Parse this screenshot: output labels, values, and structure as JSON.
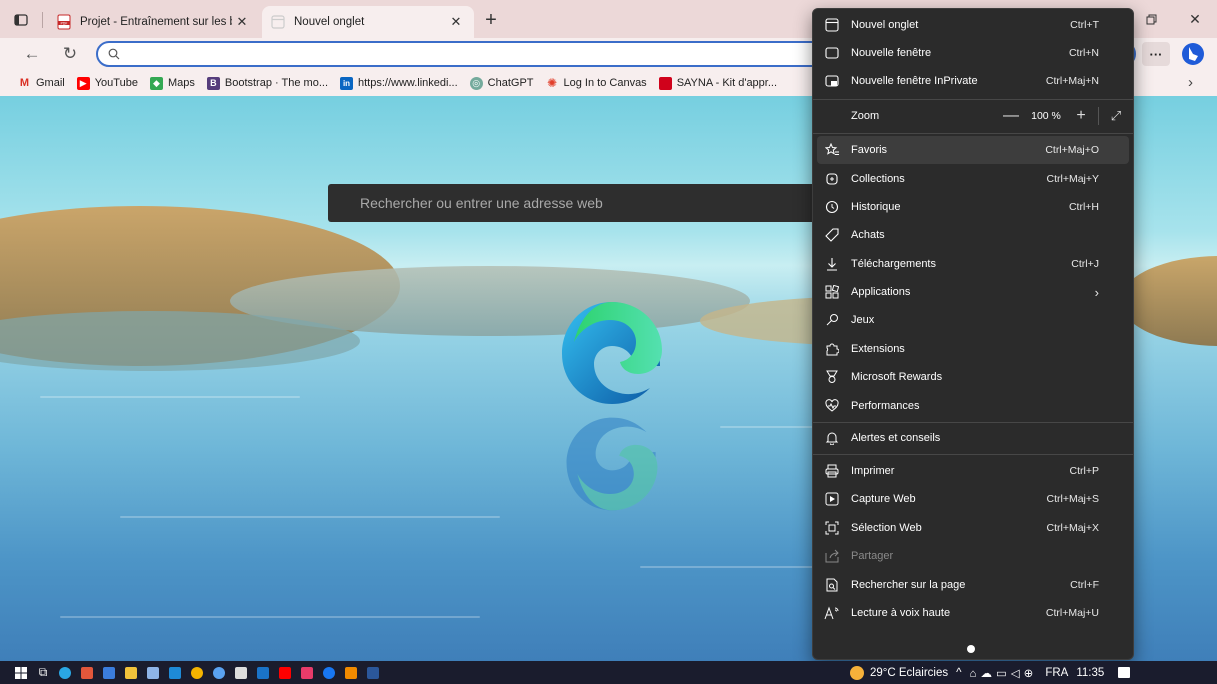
{
  "tabs": [
    {
      "title": "Projet - Entraînement sur les bas",
      "icon": "pdf-icon",
      "active": false
    },
    {
      "title": "Nouvel onglet",
      "icon": "new-tab-page-icon",
      "active": true
    }
  ],
  "address_bar": {
    "value": "",
    "placeholder": ""
  },
  "favorites": [
    {
      "label": "Gmail",
      "icon": "gmail-icon",
      "color": "#d93025",
      "glyph": "M"
    },
    {
      "label": "YouTube",
      "icon": "youtube-icon",
      "color": "#ff0000",
      "glyph": "▶"
    },
    {
      "label": "Maps",
      "icon": "maps-icon",
      "color": "#34a853",
      "glyph": "◆"
    },
    {
      "label": "Bootstrap · The mo...",
      "icon": "bootstrap-icon",
      "color": "#563d7c",
      "glyph": "B"
    },
    {
      "label": "https://www.linkedi...",
      "icon": "linkedin-icon",
      "color": "#0a66c2",
      "glyph": "in"
    },
    {
      "label": "ChatGPT",
      "icon": "chatgpt-icon",
      "color": "#74aa9c",
      "glyph": "◎"
    },
    {
      "label": "Log In to Canvas",
      "icon": "canvas-icon",
      "color": "#e13f2b",
      "glyph": "✺"
    },
    {
      "label": "SAYNA - Kit d'appr...",
      "icon": "sayna-icon",
      "color": "#d0021b",
      "glyph": "■"
    }
  ],
  "new_tab": {
    "search_placeholder": "Rechercher ou entrer une adresse web"
  },
  "menu": {
    "items_top": [
      {
        "label": "Nouvel onglet",
        "shortcut": "Ctrl+T",
        "icon": "new-tab-icon"
      },
      {
        "label": "Nouvelle fenêtre",
        "shortcut": "Ctrl+N",
        "icon": "new-window-icon"
      },
      {
        "label": "Nouvelle fenêtre InPrivate",
        "shortcut": "Ctrl+Maj+N",
        "icon": "inprivate-icon"
      }
    ],
    "zoom": {
      "label": "Zoom",
      "value": "100 %",
      "minus": "—",
      "plus": "+"
    },
    "items_mid": [
      {
        "label": "Favoris",
        "shortcut": "Ctrl+Maj+O",
        "icon": "favorites-icon"
      },
      {
        "label": "Collections",
        "shortcut": "Ctrl+Maj+Y",
        "icon": "collections-icon"
      },
      {
        "label": "Historique",
        "shortcut": "Ctrl+H",
        "icon": "history-icon"
      },
      {
        "label": "Achats",
        "shortcut": "",
        "icon": "shopping-tag-icon"
      },
      {
        "label": "Téléchargements",
        "shortcut": "Ctrl+J",
        "icon": "download-icon"
      },
      {
        "label": "Applications",
        "shortcut": "",
        "icon": "apps-icon"
      },
      {
        "label": "Jeux",
        "shortcut": "",
        "icon": "games-icon"
      },
      {
        "label": "Extensions",
        "shortcut": "",
        "icon": "extensions-icon"
      },
      {
        "label": "Microsoft Rewards",
        "shortcut": "",
        "icon": "rewards-icon"
      },
      {
        "label": "Performances",
        "shortcut": "",
        "icon": "performance-icon"
      }
    ],
    "alerts": {
      "label": "Alertes et conseils",
      "icon": "bell-icon"
    },
    "items_bottom": [
      {
        "label": "Imprimer",
        "shortcut": "Ctrl+P",
        "icon": "print-icon"
      },
      {
        "label": "Capture Web",
        "shortcut": "Ctrl+Maj+S",
        "icon": "web-capture-icon"
      },
      {
        "label": "Sélection Web",
        "shortcut": "Ctrl+Maj+X",
        "icon": "web-select-icon"
      },
      {
        "label": "Partager",
        "shortcut": "",
        "icon": "share-icon"
      },
      {
        "label": "Rechercher sur la page",
        "shortcut": "Ctrl+F",
        "icon": "find-on-page-icon"
      },
      {
        "label": "Lecture à voix haute",
        "shortcut": "Ctrl+Maj+U",
        "icon": "read-aloud-icon"
      }
    ]
  },
  "taskbar": {
    "weather": "29°C  Eclaircies",
    "language": "FRA",
    "time": "11:35"
  }
}
